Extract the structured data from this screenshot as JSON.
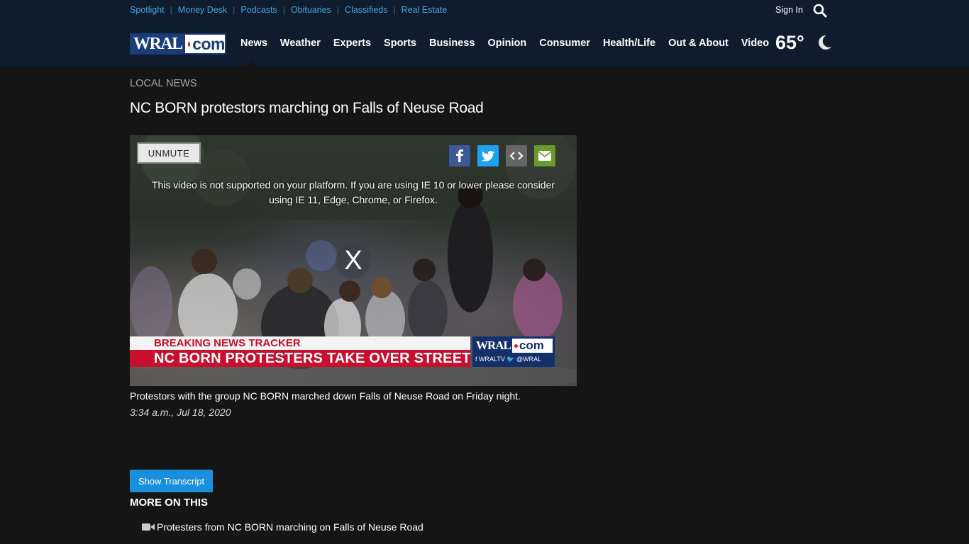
{
  "header": {
    "top_links": [
      "Spotlight",
      "Money Desk",
      "Podcasts",
      "Obituaries",
      "Classifieds",
      "Real Estate"
    ],
    "sign_in": "Sign In",
    "logo": {
      "left": "WRAL",
      "right": "com"
    },
    "nav": [
      "News",
      "Weather",
      "Experts",
      "Sports",
      "Business",
      "Opinion",
      "Consumer",
      "Health/Life",
      "Out & About",
      "Video"
    ],
    "temperature": "65°",
    "weather_icon": "moon-icon"
  },
  "article": {
    "section": "LOCAL NEWS",
    "headline": "NC BORN protestors marching on Falls of Neuse Road"
  },
  "video": {
    "unmute_label": "UNMUTE",
    "share_icons": [
      "facebook-icon",
      "twitter-icon",
      "embed-icon",
      "email-icon"
    ],
    "notice": "This video is not supported on your platform. If you are using IE 10 or lower please consider using IE 11, Edge, Chrome, or Firefox.",
    "close_label": "X",
    "ticker_label": "BREAKING NEWS TRACKER",
    "ticker_headline": "NC BORN PROTESTERS TAKE OVER STREET",
    "bug_logo": {
      "left": "WRAL",
      "right": "com"
    },
    "bug_social": "f WRALTV   🐦 @WRAL"
  },
  "caption": "Protestors with the group NC BORN marched down Falls of Neuse Road on Friday night.",
  "timestamp": "3:34 a.m., Jul 18, 2020",
  "transcript_button": "Show Transcript",
  "more_heading": "MORE ON THIS",
  "related": [
    {
      "icon": "video-camera-icon",
      "title": "Protesters from NC BORN marching on Falls of Neuse Road"
    }
  ],
  "colors": {
    "header_bg": "#0e1c2e",
    "page_bg": "#151515",
    "link_blue": "#4aa3e0",
    "button_blue": "#1a8fdd",
    "ticker_red": "#c8102e"
  }
}
